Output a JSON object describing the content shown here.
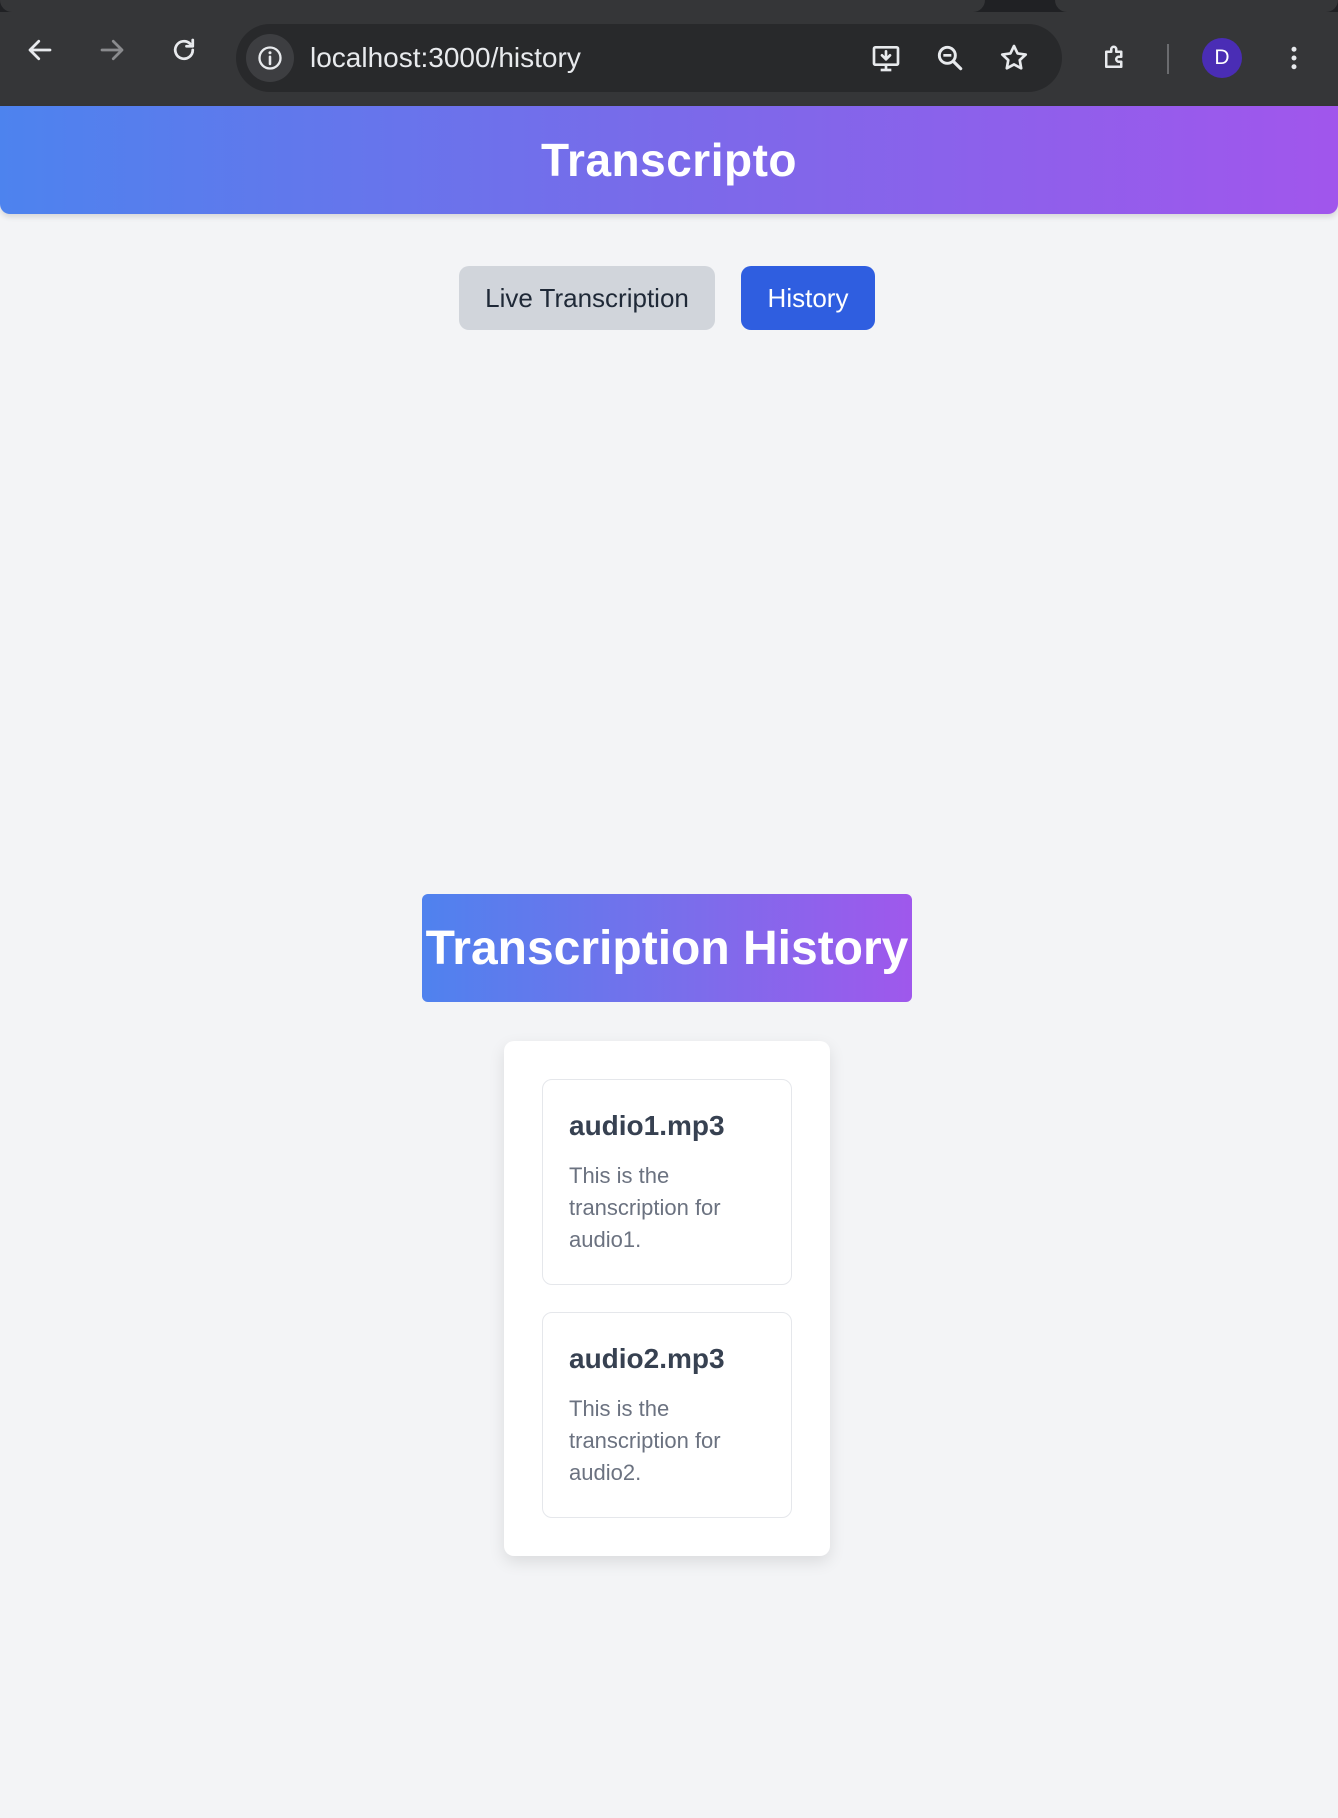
{
  "browser": {
    "url": "localhost:3000/history",
    "profile_initial": "D",
    "icons": [
      "back-icon",
      "forward-icon",
      "reload-icon",
      "site-info-icon",
      "install-app-icon",
      "zoom-icon",
      "bookmark-star-icon",
      "extensions-icon",
      "more-menu-icon"
    ]
  },
  "header": {
    "title": "Transcripto"
  },
  "nav": {
    "live_label": "Live Transcription",
    "history_label": "History",
    "active": "History"
  },
  "history": {
    "heading": "Transcription History",
    "items": [
      {
        "filename": "audio1.mp3",
        "text": "This is the transcription for audio1."
      },
      {
        "filename": "audio2.mp3",
        "text": "This is the transcription for audio2."
      }
    ]
  },
  "colors": {
    "header_gradient_start": "#4d83ee",
    "header_gradient_end": "#a156ec",
    "active_button": "#2f5ee0",
    "inactive_button": "#d1d5db",
    "page_background": "#f3f4f6"
  }
}
